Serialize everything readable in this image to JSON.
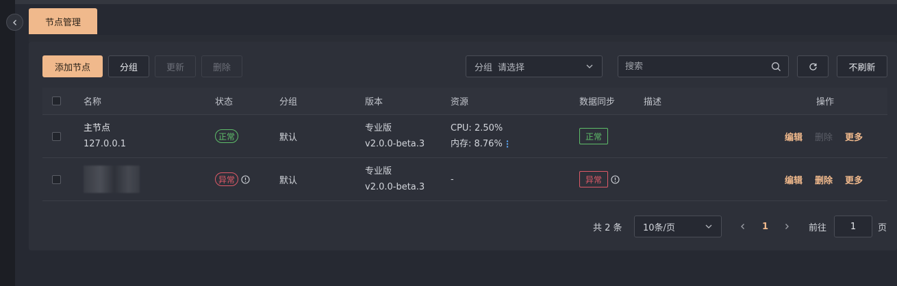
{
  "tabs": [
    {
      "label": "节点管理",
      "active": true
    }
  ],
  "toolbar": {
    "add_node": "添加节点",
    "group": "分组",
    "update": "更新",
    "delete": "删除",
    "group_filter_label": "分组",
    "group_filter_placeholder": "请选择",
    "search_placeholder": "搜索",
    "no_refresh": "不刷新"
  },
  "table": {
    "columns": [
      "名称",
      "状态",
      "分组",
      "版本",
      "资源",
      "数据同步",
      "描述",
      "操作"
    ],
    "rows": [
      {
        "name": "主节点",
        "address": "127.0.0.1",
        "status": "正常",
        "status_type": "ok",
        "group": "默认",
        "edition": "专业版",
        "version": "v2.0.0-beta.3",
        "resource_cpu": "CPU: 2.50%",
        "resource_mem": "内存: 8.76%",
        "sync": "正常",
        "sync_type": "ok",
        "description": "",
        "actions": {
          "edit": "编辑",
          "delete": "删除",
          "more": "更多"
        },
        "delete_disabled": true
      },
      {
        "name": "",
        "address": "",
        "status": "异常",
        "status_type": "error",
        "group": "默认",
        "edition": "专业版",
        "version": "v2.0.0-beta.3",
        "resource": "-",
        "sync": "异常",
        "sync_type": "error",
        "description": "",
        "actions": {
          "edit": "编辑",
          "delete": "删除",
          "more": "更多"
        },
        "delete_disabled": false
      }
    ]
  },
  "pagination": {
    "total_text": "共 2 条",
    "page_size": "10条/页",
    "current_page": "1",
    "goto_label": "前往",
    "goto_value": "1",
    "page_unit": "页"
  },
  "colors": {
    "accent": "#f0b98c",
    "ok": "#5fbf6a",
    "error": "#e05a68",
    "background": "#262932",
    "panel": "#2d3039"
  }
}
